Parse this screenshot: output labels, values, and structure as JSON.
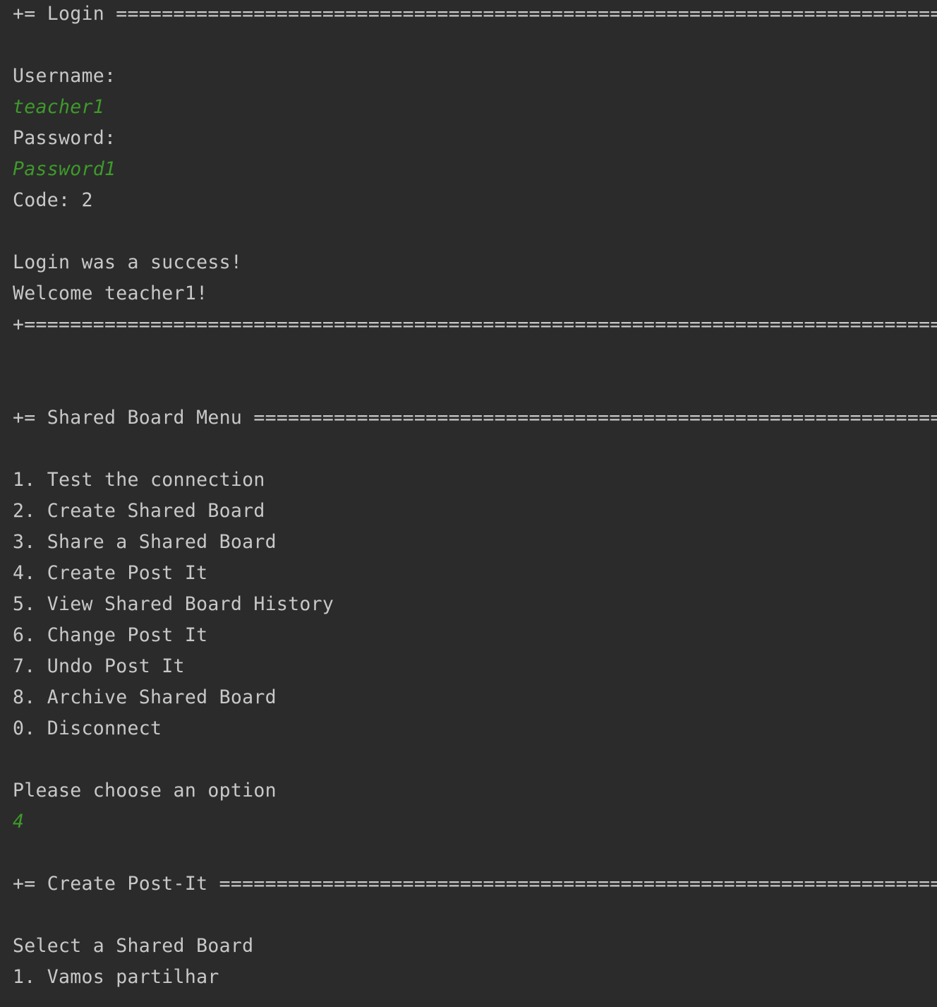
{
  "console": {
    "lines": [
      {
        "id": "login-header",
        "text": "+= Login ========================================================================+",
        "kind": "output"
      },
      {
        "id": "username-prompt",
        "text": "Username:",
        "kind": "output"
      },
      {
        "id": "username-input",
        "text": "teacher1",
        "kind": "input"
      },
      {
        "id": "password-prompt",
        "text": "Password:",
        "kind": "output"
      },
      {
        "id": "password-input",
        "text": "Password1",
        "kind": "input"
      },
      {
        "id": "code-line",
        "text": "Code: 2",
        "kind": "output"
      },
      {
        "id": "login-success",
        "text": "Login was a success!",
        "kind": "output"
      },
      {
        "id": "welcome-line",
        "text": "Welcome teacher1!",
        "kind": "output"
      },
      {
        "id": "login-footer",
        "text": "+================================================================================+",
        "kind": "output"
      },
      {
        "id": "menu-header",
        "text": "+= Shared Board Menu ============================================================+",
        "kind": "output"
      },
      {
        "id": "menu-option-1",
        "text": "1. Test the connection",
        "kind": "output"
      },
      {
        "id": "menu-option-2",
        "text": "2. Create Shared Board",
        "kind": "output"
      },
      {
        "id": "menu-option-3",
        "text": "3. Share a Shared Board",
        "kind": "output"
      },
      {
        "id": "menu-option-4",
        "text": "4. Create Post It",
        "kind": "output"
      },
      {
        "id": "menu-option-5",
        "text": "5. View Shared Board History",
        "kind": "output"
      },
      {
        "id": "menu-option-6",
        "text": "6. Change Post It",
        "kind": "output"
      },
      {
        "id": "menu-option-7",
        "text": "7. Undo Post It",
        "kind": "output"
      },
      {
        "id": "menu-option-8",
        "text": "8. Archive Shared Board",
        "kind": "output"
      },
      {
        "id": "menu-option-0",
        "text": "0. Disconnect",
        "kind": "output"
      },
      {
        "id": "choose-prompt",
        "text": "Please choose an option",
        "kind": "output"
      },
      {
        "id": "option-input",
        "text": "4",
        "kind": "input"
      },
      {
        "id": "create-postit-header",
        "text": "+= Create Post-It ===============================================================+",
        "kind": "output"
      },
      {
        "id": "select-board-prompt",
        "text": "Select a Shared Board",
        "kind": "output"
      },
      {
        "id": "board-option-1",
        "text": "1. Vamos partilhar",
        "kind": "output"
      }
    ]
  },
  "colors": {
    "background": "#2b2b2b",
    "output_text": "#c8c8c8",
    "input_text": "#3e9a2b"
  }
}
